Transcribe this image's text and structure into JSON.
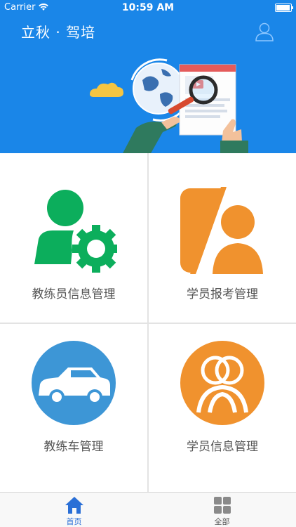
{
  "status_bar": {
    "carrier": "Carrier",
    "time": "10:59 AM"
  },
  "header": {
    "title": "立秋 · 驾培",
    "profile_icon": "person-outline-icon"
  },
  "tiles": [
    {
      "label": "教练员信息管理",
      "icon": "coach-gear-icon",
      "color": "#0cae5c"
    },
    {
      "label": "学员报考管理",
      "icon": "student-register-icon",
      "color": "#f0922e"
    },
    {
      "label": "教练车管理",
      "icon": "car-icon",
      "color": "#3d96d6"
    },
    {
      "label": "学员信息管理",
      "icon": "students-icon",
      "color": "#f0922e"
    }
  ],
  "tabbar": {
    "tabs": [
      {
        "label": "首页",
        "icon": "home-icon",
        "active": true
      },
      {
        "label": "全部",
        "icon": "grid-icon",
        "active": false
      }
    ]
  },
  "colors": {
    "brand": "#1a86e8",
    "active_tab": "#2a6fd6"
  }
}
